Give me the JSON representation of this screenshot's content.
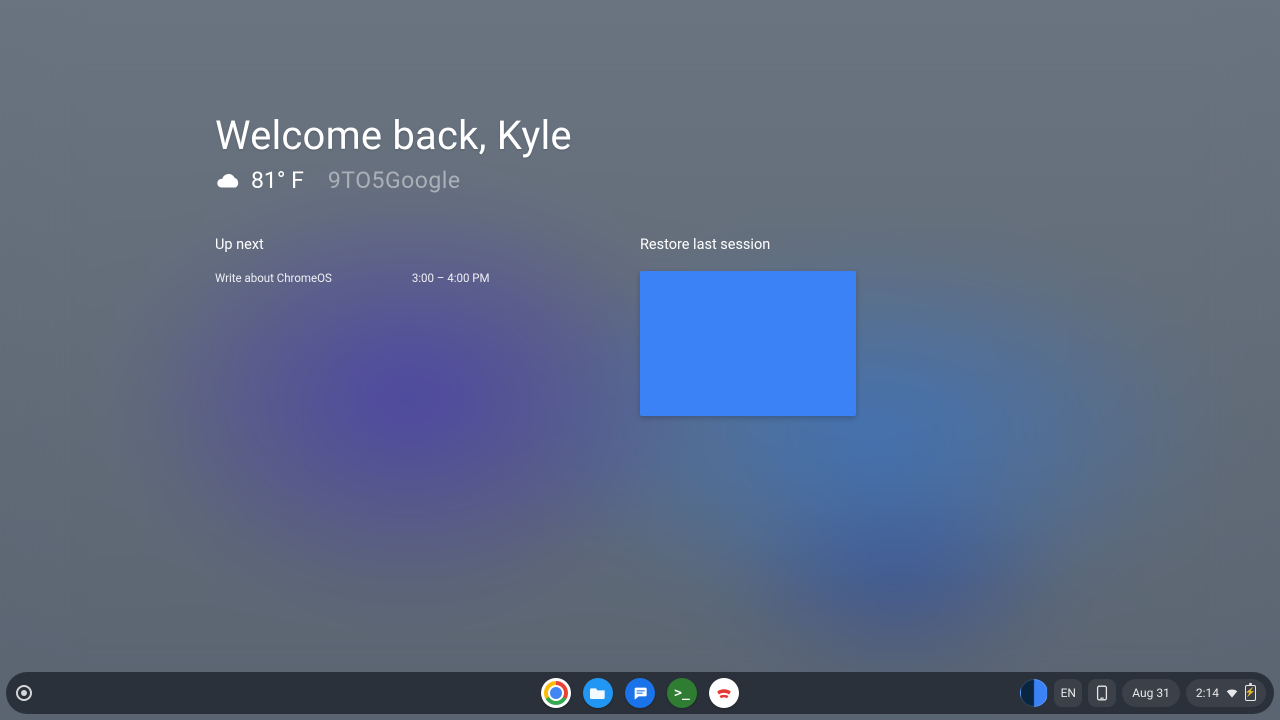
{
  "welcome": {
    "greeting": "Welcome back, Kyle"
  },
  "weather": {
    "icon_name": "cloud-icon",
    "temperature": "81° F"
  },
  "watermark": "9TO5Google",
  "up_next": {
    "heading": "Up next",
    "items": [
      {
        "title": "Write about ChromeOS",
        "time": "3:00 – 4:00 PM"
      }
    ]
  },
  "restore": {
    "heading": "Restore last session",
    "thumb_color": "#3b82f6"
  },
  "shelf": {
    "apps": [
      {
        "name": "chrome",
        "label": "Google Chrome"
      },
      {
        "name": "files",
        "label": "Files"
      },
      {
        "name": "messages",
        "label": "Messages"
      },
      {
        "name": "terminal",
        "label": "Terminal"
      },
      {
        "name": "stadia",
        "label": "Stadia"
      }
    ]
  },
  "status": {
    "language": "EN",
    "date": "Aug 31",
    "time": "2:14"
  }
}
